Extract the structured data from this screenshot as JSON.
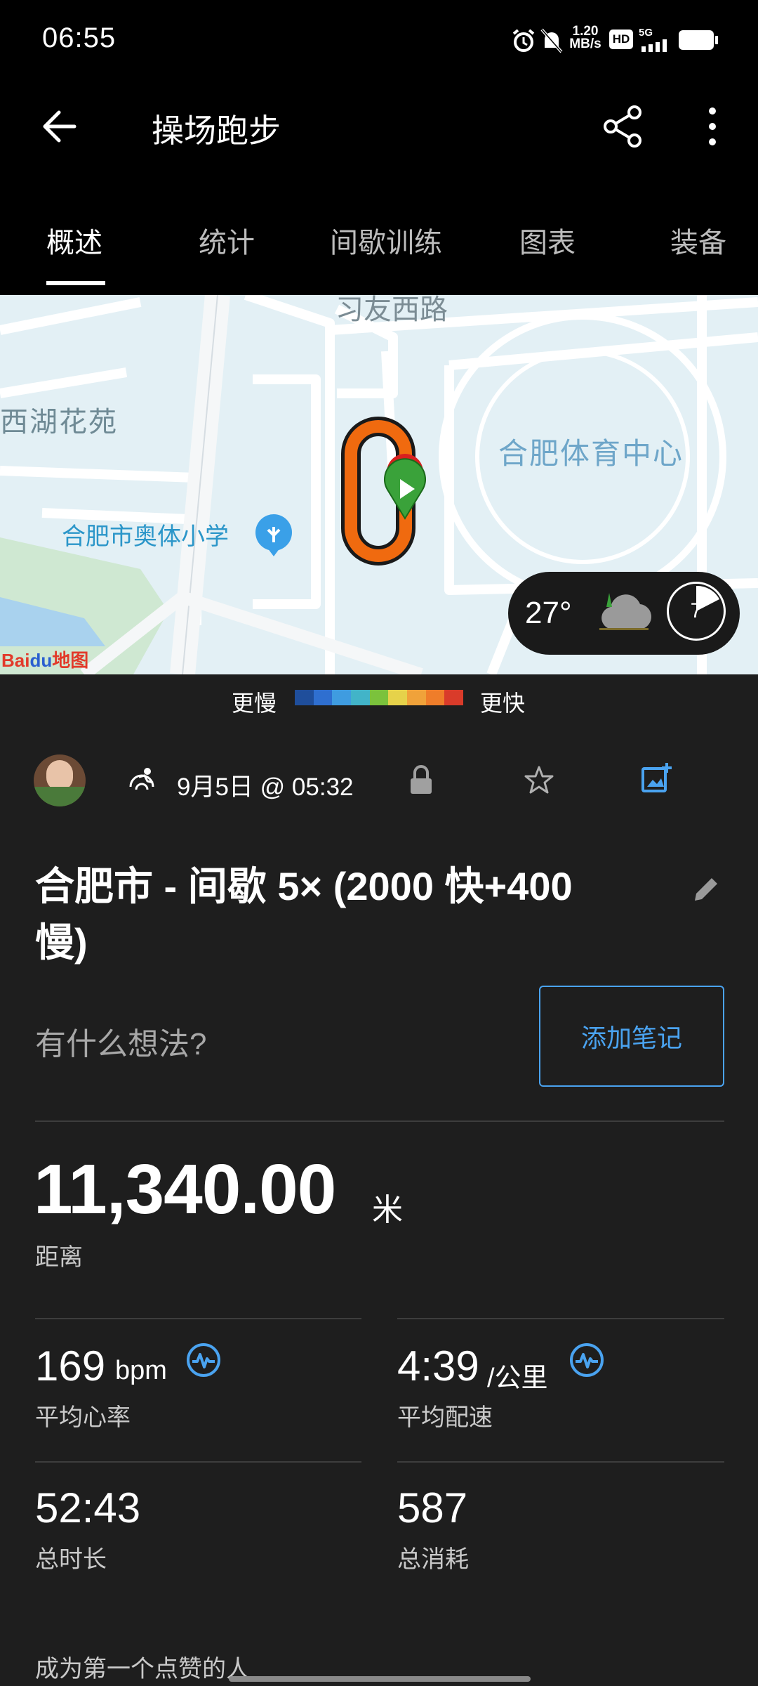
{
  "status_bar": {
    "time": "06:55",
    "net_speed_value": "1.20",
    "net_speed_unit": "MB/s",
    "hd": "HD",
    "network": "5G"
  },
  "header": {
    "title": "操场跑步",
    "back_icon": "arrow-left-icon",
    "share_icon": "share-icon",
    "more_icon": "more-vertical-icon"
  },
  "tabs": [
    {
      "label": "概述",
      "active": true
    },
    {
      "label": "统计",
      "active": false
    },
    {
      "label": "间歇训练",
      "active": false
    },
    {
      "label": "图表",
      "active": false
    },
    {
      "label": "装备",
      "active": false
    }
  ],
  "map": {
    "road_label": "习友西路",
    "area_label_1": "西湖花苑",
    "area_label_2": "合肥体育中心",
    "poi_label": "合肥市奥体小学",
    "attribution_brand": "Bai",
    "attribution_du": "du",
    "attribution_map": "地图",
    "weather": {
      "temperature": "27°",
      "wind": "7"
    }
  },
  "pace_legend": {
    "slower": "更慢",
    "faster": "更快",
    "colors": [
      "#1f4e9b",
      "#2f6fd0",
      "#3f9ce0",
      "#42b4c8",
      "#7bc23c",
      "#e6d24a",
      "#f0a23a",
      "#ef7d2a",
      "#d93b2a"
    ]
  },
  "activity": {
    "date": "9月5日 @ 05:32",
    "title": "合肥市 - 间歇 5× (2000 快+400 慢)",
    "thoughts_placeholder": "有什么想法?",
    "add_note_label": "添加笔记"
  },
  "stats": {
    "distance": {
      "value": "11,340.00",
      "unit": "米",
      "label": "距离"
    },
    "avg_hr": {
      "value": "169",
      "unit": "bpm",
      "label": "平均心率"
    },
    "avg_pace": {
      "value": "4:39",
      "unit": "/公里",
      "label": "平均配速"
    },
    "duration": {
      "value": "52:43",
      "label": "总时长"
    },
    "calories": {
      "value": "587",
      "label": "总消耗"
    }
  },
  "footer": {
    "likes_text": "成为第一个点赞的人"
  },
  "colors": {
    "accent": "#4aa3f0",
    "route": "#f06a0f",
    "background": "#1e1e1e"
  }
}
